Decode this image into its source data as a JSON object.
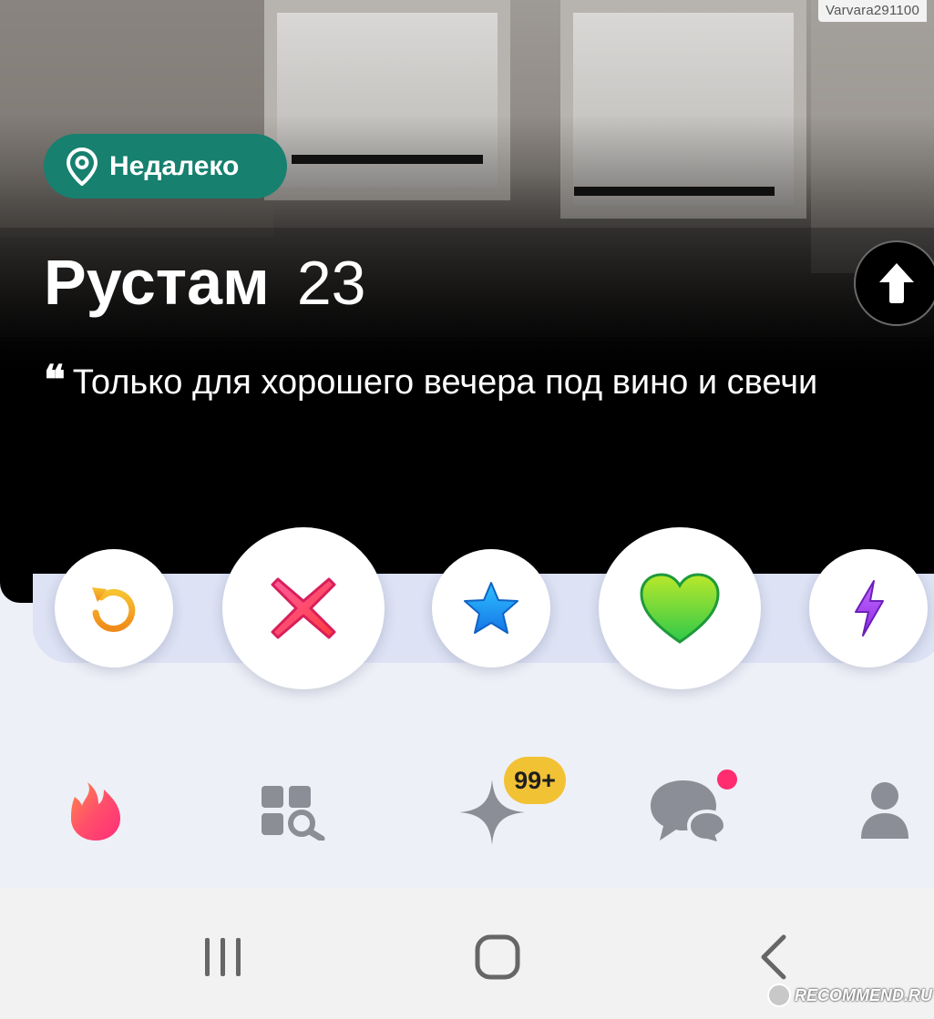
{
  "profile": {
    "distance_label": "Недалеко",
    "name": "Рустам",
    "age": "23",
    "bio_quote_mark": "❝",
    "bio": "Только для хорошего вечера под вино и свечи"
  },
  "watermarks": {
    "username": "Varvara291100",
    "site": "RECOMMEND.RU"
  },
  "actions": [
    {
      "name": "rewind",
      "icon": "rewind-icon",
      "color": "#f5a623"
    },
    {
      "name": "nope",
      "icon": "close-icon",
      "color": "#ff3d7f"
    },
    {
      "name": "super-like",
      "icon": "star-icon",
      "color": "#1a9bf0"
    },
    {
      "name": "like",
      "icon": "heart-icon",
      "color": "#5ccf2b"
    },
    {
      "name": "boost",
      "icon": "lightning-icon",
      "color": "#a440f0"
    }
  ],
  "bottom_nav": {
    "items": [
      {
        "name": "home",
        "icon": "flame-icon",
        "active": true
      },
      {
        "name": "explore",
        "icon": "explore-icon"
      },
      {
        "name": "likes-you",
        "icon": "sparkle-icon"
      },
      {
        "name": "messages",
        "icon": "chat-icon"
      },
      {
        "name": "profile",
        "icon": "person-icon"
      }
    ],
    "likes_badge": "99+",
    "accent": "#ff4d6d"
  },
  "system_nav": [
    "recent-apps",
    "home",
    "back"
  ]
}
